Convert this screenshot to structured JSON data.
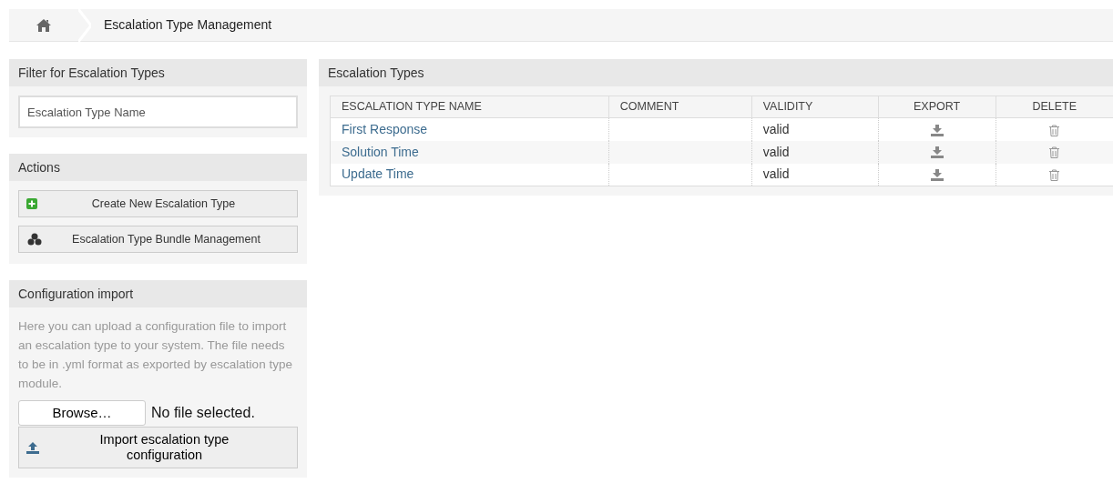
{
  "breadcrumb": {
    "title": "Escalation Type Management"
  },
  "filter": {
    "title": "Filter for Escalation Types",
    "placeholder": "Escalation Type Name"
  },
  "actions": {
    "title": "Actions",
    "buttons": [
      {
        "label": "Create New Escalation Type",
        "kind": "add"
      },
      {
        "label": "Escalation Type Bundle Management",
        "kind": "bundle"
      }
    ]
  },
  "import": {
    "title": "Configuration import",
    "description": "Here you can upload a configuration file to import an escalation type to your system. The file needs to be in .yml format as exported by escalation type module.",
    "browse": "Browse…",
    "file_status": "No file selected.",
    "button": "Import escalation type configuration"
  },
  "table": {
    "title": "Escalation Types",
    "columns": [
      "ESCALATION TYPE NAME",
      "COMMENT",
      "VALIDITY",
      "EXPORT",
      "DELETE"
    ],
    "rows": [
      {
        "name": "First Response",
        "validity": "valid"
      },
      {
        "name": "Solution Time",
        "validity": "valid"
      },
      {
        "name": "Update Time",
        "validity": "valid"
      }
    ]
  }
}
